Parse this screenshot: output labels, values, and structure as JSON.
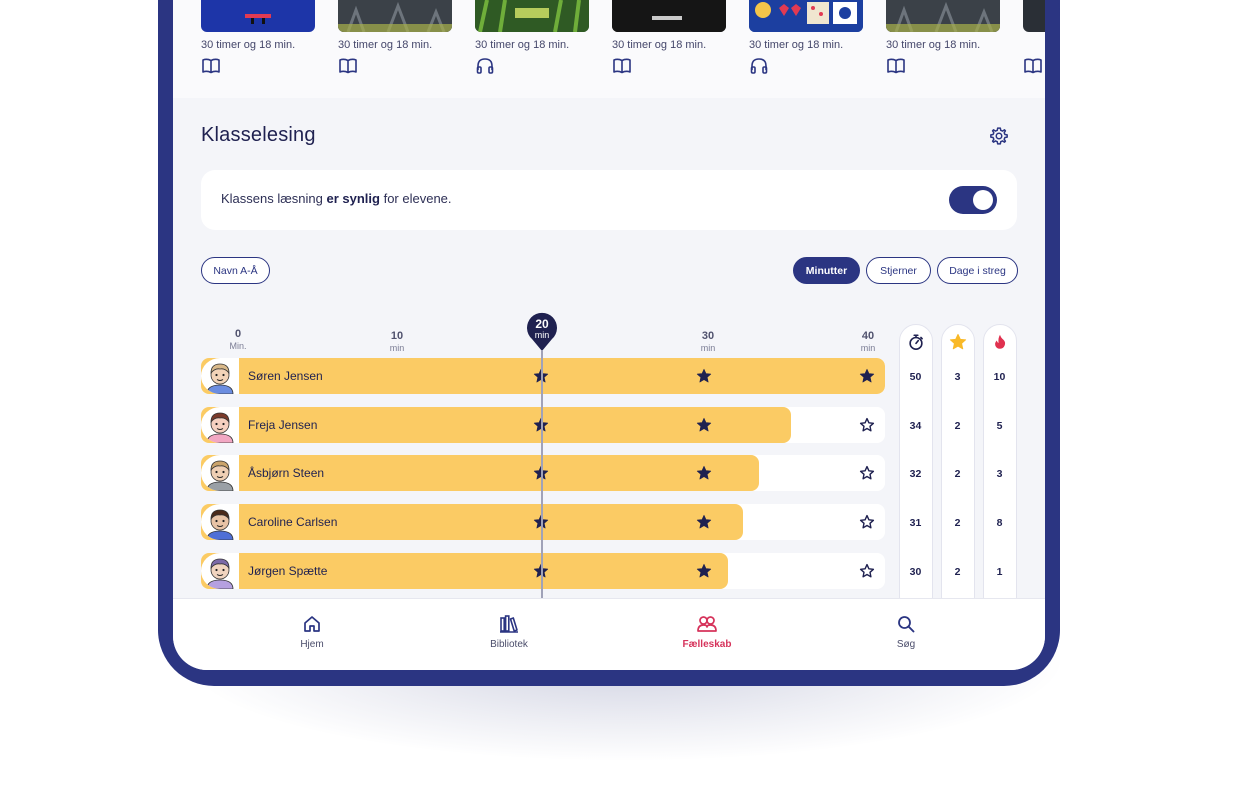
{
  "carousel": {
    "books": [
      {
        "duration": "30 timer og 18 min.",
        "type": "book-icon"
      },
      {
        "duration": "30 timer og 18 min.",
        "type": "book-icon"
      },
      {
        "duration": "30 timer og 18 min.",
        "type": "headphones-icon"
      },
      {
        "duration": "30 timer og 18 min.",
        "type": "book-icon"
      },
      {
        "duration": "30 timer og 18 min.",
        "type": "headphones-icon"
      },
      {
        "duration": "30 timer og 18 min.",
        "type": "book-icon"
      },
      {
        "duration": "",
        "type": "book-icon"
      }
    ]
  },
  "section": {
    "title": "Klasselesing",
    "visibility_prefix": "Klassens læsning ",
    "visibility_bold": "er synlig",
    "visibility_suffix": " for elevene.",
    "visible": true
  },
  "filters": {
    "sort_label": "Navn A-Å",
    "tabs": [
      "Minutter",
      "Stjerner",
      "Dage i streg"
    ],
    "active_tab": "Minutter"
  },
  "scale": {
    "ticks": [
      {
        "value": "0",
        "unit": "Min."
      },
      {
        "value": "10",
        "unit": "min"
      },
      {
        "value": "30",
        "unit": "min"
      },
      {
        "value": "40",
        "unit": "min"
      }
    ],
    "goal": {
      "value": "20",
      "unit": "min"
    },
    "max_minutes": 40
  },
  "columns": {
    "icons": [
      "stopwatch-icon",
      "star-icon",
      "flame-icon"
    ],
    "colors": {
      "star": "#f9b928",
      "flame": "#e0314f"
    }
  },
  "students": [
    {
      "name": "Søren Jensen",
      "minutes": 50,
      "stars": 3,
      "streak": 10,
      "stars_earned": [
        true,
        true,
        true
      ]
    },
    {
      "name": "Freja Jensen",
      "minutes": 34,
      "stars": 2,
      "streak": 5,
      "stars_earned": [
        true,
        true,
        false
      ]
    },
    {
      "name": "Åsbjørn Steen",
      "minutes": 32,
      "stars": 2,
      "streak": 3,
      "stars_earned": [
        true,
        true,
        false
      ]
    },
    {
      "name": "Caroline Carlsen",
      "minutes": 31,
      "stars": 2,
      "streak": 8,
      "stars_earned": [
        true,
        true,
        false
      ]
    },
    {
      "name": "Jørgen Spætte",
      "minutes": 30,
      "stars": 2,
      "streak": 1,
      "stars_earned": [
        true,
        true,
        false
      ]
    }
  ],
  "nav": {
    "items": [
      {
        "label": "Hjem",
        "icon": "home-icon"
      },
      {
        "label": "Bibliotek",
        "icon": "library-icon"
      },
      {
        "label": "Fælleskab",
        "icon": "community-icon"
      },
      {
        "label": "Søg",
        "icon": "search-icon"
      }
    ],
    "active": "Fælleskab"
  },
  "colors": {
    "primary": "#2b3582",
    "bar": "#fbcb64",
    "active_nav": "#d6335b"
  }
}
